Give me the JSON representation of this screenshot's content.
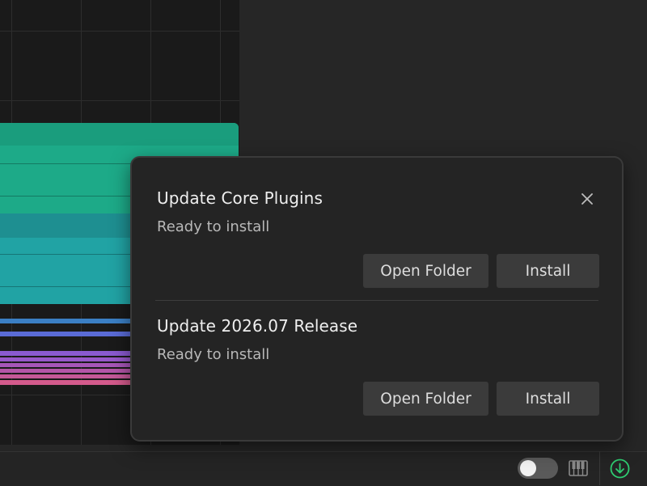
{
  "notifications": [
    {
      "title": "Update Core Plugins",
      "status": "Ready to install",
      "open_folder_label": "Open Folder",
      "install_label": "Install"
    },
    {
      "title": "Update 2026.07 Release",
      "status": "Ready to install",
      "open_folder_label": "Open Folder",
      "install_label": "Install"
    }
  ],
  "icons": {
    "close": "close-icon",
    "piano": "piano-icon",
    "download": "download-icon"
  },
  "toggle": {
    "state": "off"
  },
  "colors": {
    "clip_green": "#1daa88",
    "clip_teal": "#21a3a4",
    "stripe_blue": "#3b7fc4",
    "stripe_indigo": "#5a6bd6",
    "stripe_purple": "#8a5ad0",
    "stripe_pink": "#d45a8c",
    "download_accent": "#2ecc71"
  }
}
